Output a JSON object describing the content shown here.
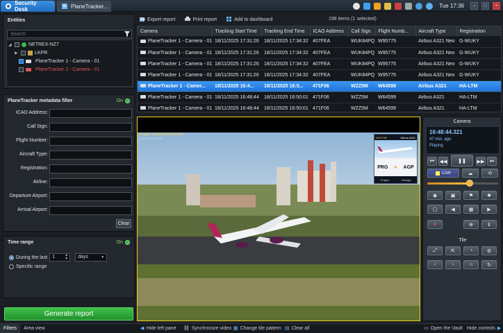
{
  "tabs": {
    "home": "Security Desk",
    "active": "PlaneTracker..."
  },
  "tray": {
    "clock": "Tue 17:36"
  },
  "entities": {
    "title": "Entities",
    "search_placeholder": "Search",
    "tree": [
      {
        "label": "NETREX-NZ7",
        "checked": false,
        "red": false
      },
      {
        "label": "LKPR",
        "checked": false,
        "red": false
      },
      {
        "label": "PlaneTracker 1 - Camera - 01",
        "checked": true,
        "red": false
      },
      {
        "label": "PlaneTracker 2 - Camera - 01",
        "checked": false,
        "red": true
      }
    ]
  },
  "metadata_filter": {
    "title": "PlaneTracker metadata filter",
    "toggle": "On",
    "fields": [
      "ICAO Address:",
      "Call Sign:",
      "Flight Number:",
      "Aircraft Type:",
      "Registration:",
      "Airline:",
      "Departure Airport:",
      "Arrival Airport:"
    ],
    "clear": "Clear"
  },
  "time_range": {
    "title": "Time range",
    "toggle": "On",
    "during_last": "During the last",
    "value": "1",
    "unit": "days",
    "specific": "Specific range"
  },
  "generate": "Generate report",
  "bottom": {
    "tab_filters": "Filters",
    "tab_area": "Area view",
    "hide_left": "Hide left pane",
    "sync_video": "Synchronize video",
    "change_tile": "Change tile pattern",
    "clear_all": "Clear all",
    "open_vault": "Open the Vault",
    "hide_controls": "Hide controls"
  },
  "toolbar": {
    "export": "Export report",
    "print": "Print report",
    "add_dashboard": "Add to dashboard",
    "count": "198 items (1 selected)"
  },
  "table": {
    "columns": [
      "Camera",
      "Tracking Start Time",
      "Tracking End Time",
      "ICAO Address",
      "Call Sign",
      "Flight Numb...",
      "Aircraft Type",
      "Registration"
    ],
    "rows": [
      [
        "PlaneTracker 1 - Camera - 01",
        "18/11/2025 17:31:26",
        "18/11/2025 17:34:32",
        "407FEA",
        "WUK84PQ",
        "W95775",
        "Airbus A321 Neo",
        "G-WUKY"
      ],
      [
        "PlaneTracker 1 - Camera - 01",
        "18/11/2025 17:31:26",
        "18/11/2025 17:34:32",
        "407FEA",
        "WUK84PQ",
        "W95775",
        "Airbus A321 Neo",
        "G-WUKY"
      ],
      [
        "PlaneTracker 1 - Camera - 01",
        "18/11/2025 17:31:26",
        "18/11/2025 17:34:32",
        "407FEA",
        "WUK84PQ",
        "W95775",
        "Airbus A321 Neo",
        "G-WUKY"
      ],
      [
        "PlaneTracker 1 - Camera - 01",
        "18/11/2025 17:31:26",
        "18/11/2025 17:34:32",
        "407FEA",
        "WUK84PQ",
        "W95775",
        "Airbus A321 Neo",
        "G-WUKY"
      ],
      [
        "PlaneTracker 1 - Camer...",
        "18/11/2025 16:4...",
        "18/11/2025 16:5...",
        "471F06",
        "WZZ5M",
        "W64599",
        "Airbus A321",
        "HA-LTM"
      ],
      [
        "PlaneTracker 1 - Camera - 01",
        "18/11/2025 16:48:44",
        "18/11/2025 16:50:01",
        "471F06",
        "WZZ5M",
        "W64599",
        "Airbus A321",
        "HA-LTM"
      ],
      [
        "PlaneTracker 1 - Camera - 01",
        "18/11/2025 16:48:44",
        "18/11/2025 16:50:01",
        "471F06",
        "WZZ5M",
        "W64599",
        "Airbus A321",
        "HA-LTM"
      ]
    ],
    "selected_index": 4
  },
  "tile": {
    "caption": "Prague Václav Havel Airport",
    "caption2": "2025-11-18 16:48",
    "overlay": {
      "flight": "EWG760",
      "type": "Airbus A321",
      "from": "PRG",
      "to": "AGP",
      "from_city": "Prague",
      "to_city": "Malaga"
    }
  },
  "camera": {
    "title": "Camera",
    "time": "16:48:44.321",
    "ago": "47 min. ago",
    "state": "Playing",
    "live": "Live",
    "tile_title": "Tile",
    "speed_fraction": 0.6
  },
  "colors": {
    "accent": "#1f74d6",
    "generate": "#2fa83a",
    "tile_border": "#f0d21c"
  }
}
